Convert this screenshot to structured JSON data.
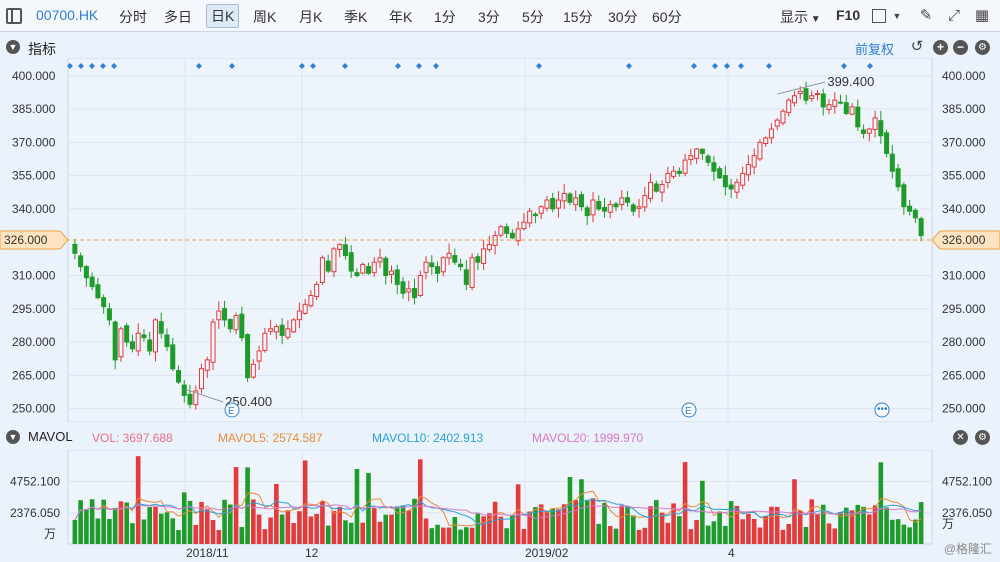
{
  "toolbar": {
    "symbol": "00700.HK",
    "periods": [
      "分时",
      "多日",
      "日K",
      "周K",
      "月K",
      "季K",
      "年K",
      "1分",
      "3分",
      "5分",
      "15分",
      "30分",
      "60分"
    ],
    "active_period": "日K",
    "display_label": "显示",
    "f10_label": "F10"
  },
  "main_panel": {
    "title": "指标",
    "adjust_label": "前复权",
    "current_price": "326.000",
    "high_label": "399.400",
    "low_label": "250.400",
    "event_marker": "E"
  },
  "vol_panel": {
    "title": "MAVOL",
    "vol": "VOL: 3697.688",
    "mavol5": "MAVOL5: 2574.587",
    "mavol10": "MAVOL10: 2402.913",
    "mavol20": "MAVOL20: 1999.970",
    "unit": "万",
    "y_ticks": [
      "4752.100",
      "2376.050"
    ]
  },
  "colors": {
    "up": "#e23b3b",
    "down": "#1f9b2a",
    "accent": "#2f7fd8",
    "price_line": "#f0a040"
  },
  "x_labels": [
    "2018/11",
    "12",
    "2019/02",
    "4"
  ],
  "watermark": "@格隆汇",
  "chart_data": {
    "type": "candlestick",
    "y_ticks": [
      400,
      385,
      370,
      355,
      340,
      326,
      310,
      295,
      280,
      265,
      250
    ],
    "ylim": [
      244,
      408
    ],
    "closes": [
      320,
      314,
      309,
      305,
      300,
      296,
      290,
      272,
      286,
      280,
      277,
      284,
      282,
      276,
      290,
      284,
      278,
      268,
      262,
      256,
      252,
      258,
      268,
      272,
      289,
      294,
      290,
      286,
      292,
      282,
      264,
      270,
      276,
      284,
      286,
      287,
      283,
      286,
      290,
      294,
      297,
      301,
      306,
      318,
      312,
      322,
      324,
      319,
      312,
      310,
      315,
      311,
      316,
      318,
      310,
      312,
      306,
      302,
      304,
      300,
      310,
      316,
      314,
      311,
      318,
      320,
      316,
      314,
      306,
      318,
      316,
      322,
      324,
      328,
      332,
      329,
      327,
      331,
      334,
      339,
      337,
      341,
      344,
      340,
      344,
      347,
      343,
      345,
      341,
      337,
      344,
      340,
      339,
      342,
      341,
      345,
      343,
      339,
      341,
      346,
      352,
      348,
      351,
      356,
      357,
      356,
      362,
      364,
      367,
      365,
      361,
      357,
      354,
      350,
      349,
      352,
      356,
      360,
      364,
      370,
      372,
      376,
      380,
      384,
      389,
      391,
      393,
      389,
      391,
      392,
      386,
      387,
      389,
      388,
      383,
      386,
      377,
      374,
      376,
      381,
      373,
      365,
      357,
      350,
      341,
      339,
      336,
      328
    ]
  }
}
